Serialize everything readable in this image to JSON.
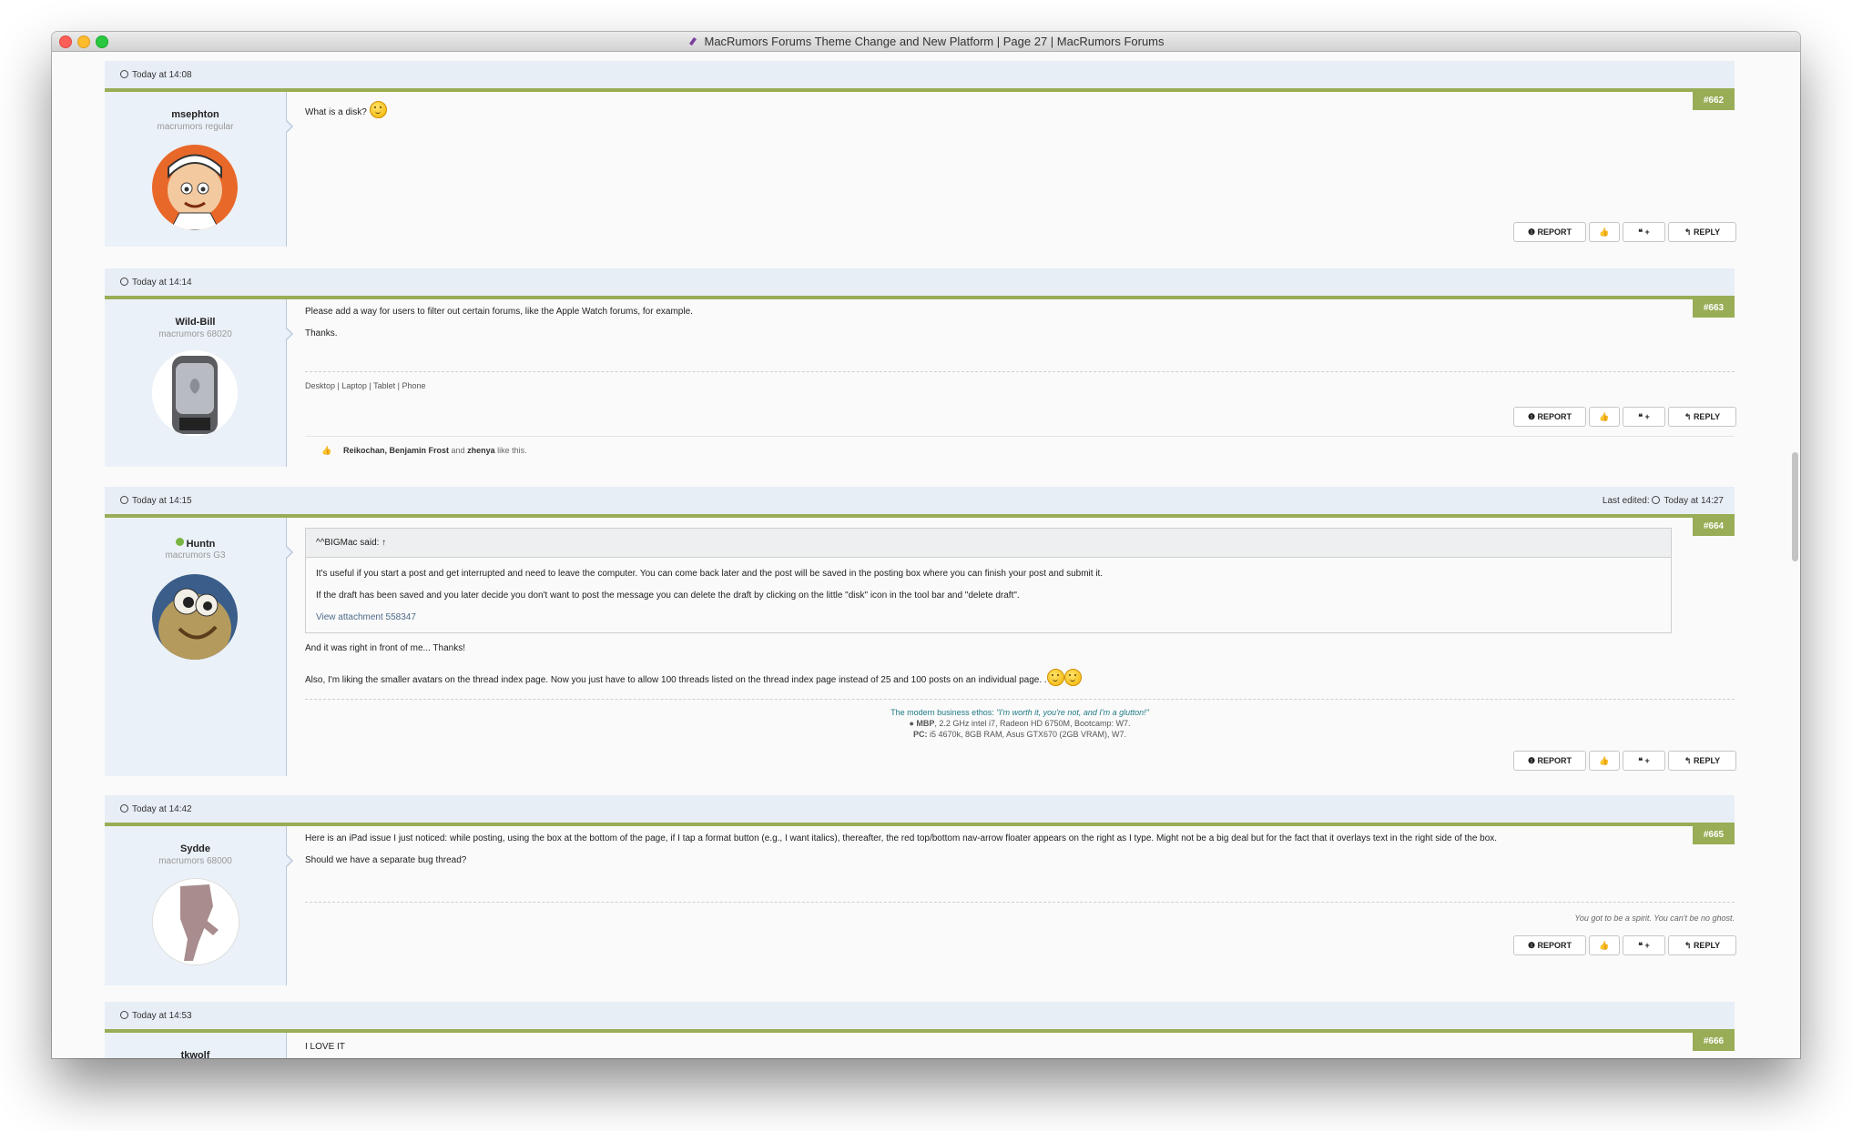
{
  "window": {
    "title": "MacRumors Forums Theme Change and New Platform | Page 27 | MacRumors Forums"
  },
  "buttons": {
    "report": "REPORT",
    "like": "",
    "quote": "+",
    "reply": "REPLY"
  },
  "posts": [
    {
      "date": "Today at 14:08",
      "number": "#662",
      "username": "msephton",
      "rank": "macrumors regular",
      "body": [
        "What is a disk?"
      ]
    },
    {
      "date": "Today at 14:14",
      "number": "#663",
      "username": "Wild-Bill",
      "rank": "macrumors 68020",
      "body": [
        "Please add a way for users to filter out certain forums, like the Apple Watch forums, for example.",
        "Thanks."
      ],
      "sig_links": [
        "Desktop",
        "Laptop",
        "Tablet",
        "Phone"
      ],
      "likes": {
        "names": "Reikochan, Benjamin Frost",
        "and": "and",
        "last": "zhenya",
        "suffix": "like this."
      }
    },
    {
      "date": "Today at 14:15",
      "edited_label": "Last edited:",
      "edited_time": "Today at 14:27",
      "number": "#664",
      "username": "Huntn",
      "rank": "macrumors G3",
      "quote": {
        "header": "^^BIGMac said: ↑",
        "lines": [
          "It's useful if you start a post and get interrupted and need to leave the computer. You can come back later and the post will be saved in the posting box where you can finish your post and submit it.",
          "If the draft has been saved and you later decide you don't want to post the message you can delete the draft by clicking on the little \"disk\" icon in the tool bar and \"delete draft\"."
        ],
        "attachment": "View attachment 558347"
      },
      "body": [
        "And it was right in front of me... Thanks!",
        "Also, I'm liking the smaller avatars on the thread index page. Now you just have to allow 100 threads listed on the thread index page instead of 25 and 100 posts on an individual page. ."
      ],
      "signature": {
        "line1_prefix": "The modern business ethos: ",
        "line1_quote": "\"I'm worth it, you're not, and I'm a glutton!\"",
        "line2_bold": "MBP",
        "line2": ", 2.2 GHz intel i7, Radeon HD 6750M, Bootcamp: W7.",
        "line3_bold": "PC:",
        "line3": " i5 4670k, 8GB RAM, Asus GTX670 (2GB VRAM), W7."
      }
    },
    {
      "date": "Today at 14:42",
      "number": "#665",
      "username": "Sydde",
      "rank": "macrumors 68000",
      "body": [
        "Here is an iPad issue I just noticed: while posting, using the box at the bottom of the page, if I tap a format button (e.g., I want italics), thereafter, the red top/bottom nav-arrow floater appears on the right as I type. Might not be a big deal but for the fact that it overlays text in the right side of the box.",
        "Should we have a separate bug thread?"
      ],
      "signature": "You got to be a spirit. You can't be no ghost."
    },
    {
      "date": "Today at 14:53",
      "number": "#666",
      "username": "tkwolf",
      "body": [
        "I LOVE IT"
      ]
    }
  ]
}
